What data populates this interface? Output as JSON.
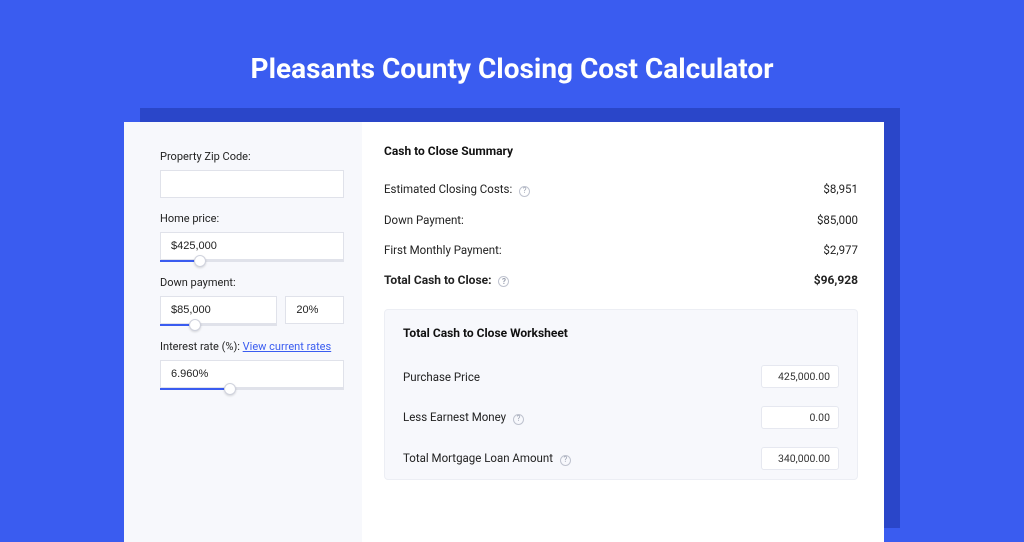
{
  "title": "Pleasants County Closing Cost Calculator",
  "colors": {
    "accent": "#3a5cf0",
    "panel_shadow": "#2a46c9"
  },
  "left": {
    "zip": {
      "label": "Property Zip Code:",
      "value": ""
    },
    "price": {
      "label": "Home price:",
      "value": "$425,000",
      "slider_pct": 22
    },
    "down": {
      "label": "Down payment:",
      "amount": "$85,000",
      "pct": "20%",
      "slider_pct": 30
    },
    "rate": {
      "label_prefix": "Interest rate (%): ",
      "link_text": "View current rates",
      "value": "6.960%",
      "slider_pct": 38
    }
  },
  "summary": {
    "heading": "Cash to Close Summary",
    "rows": [
      {
        "label": "Estimated Closing Costs:",
        "help": true,
        "value": "$8,951"
      },
      {
        "label": "Down Payment:",
        "help": false,
        "value": "$85,000"
      },
      {
        "label": "First Monthly Payment:",
        "help": false,
        "value": "$2,977"
      }
    ],
    "total": {
      "label": "Total Cash to Close:",
      "help": true,
      "value": "$96,928"
    }
  },
  "worksheet": {
    "heading": "Total Cash to Close Worksheet",
    "rows": [
      {
        "label": "Purchase Price",
        "help": false,
        "value": "425,000.00"
      },
      {
        "label": "Less Earnest Money",
        "help": true,
        "value": "0.00"
      },
      {
        "label": "Total Mortgage Loan Amount",
        "help": true,
        "value": "340,000.00"
      }
    ]
  }
}
